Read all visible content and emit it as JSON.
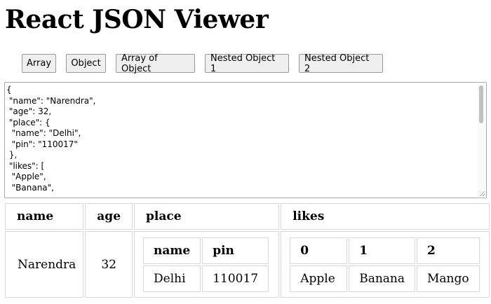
{
  "header": {
    "title": "React JSON Viewer"
  },
  "buttons": [
    "Array",
    "Object",
    "Array of Object",
    "Nested Object 1",
    "Nested Object 2"
  ],
  "json_editor": {
    "text": "{\n \"name\": \"Narendra\",\n \"age\": 32,\n \"place\": {\n  \"name\": \"Delhi\",\n  \"pin\": \"110017\"\n },\n \"likes\": [\n  \"Apple\",\n  \"Banana\","
  },
  "table": {
    "headers": [
      "name",
      "age",
      "place",
      "likes"
    ],
    "row": {
      "name": "Narendra",
      "age": "32",
      "place": {
        "headers": [
          "name",
          "pin"
        ],
        "values": [
          "Delhi",
          "110017"
        ]
      },
      "likes": {
        "headers": [
          "0",
          "1",
          "2"
        ],
        "values": [
          "Apple",
          "Banana",
          "Mango"
        ]
      }
    }
  }
}
